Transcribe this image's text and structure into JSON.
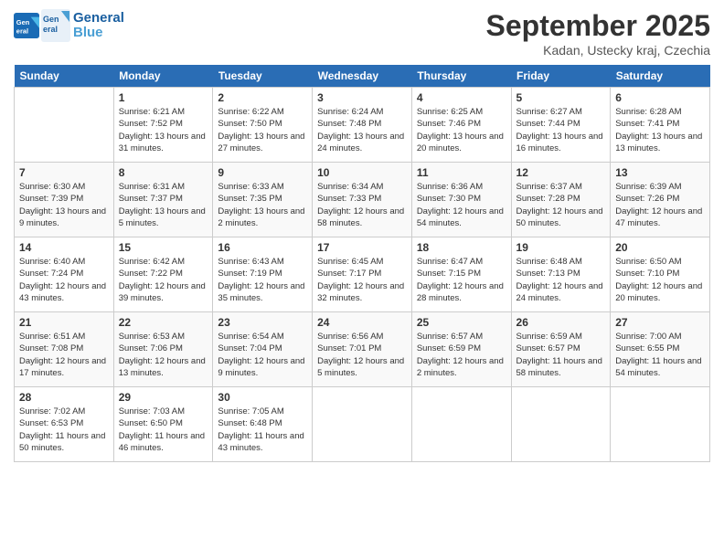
{
  "header": {
    "logo_line1": "General",
    "logo_line2": "Blue",
    "month_title": "September 2025",
    "location": "Kadan, Ustecky kraj, Czechia"
  },
  "days_of_week": [
    "Sunday",
    "Monday",
    "Tuesday",
    "Wednesday",
    "Thursday",
    "Friday",
    "Saturday"
  ],
  "weeks": [
    [
      {
        "num": "",
        "empty": true
      },
      {
        "num": "1",
        "sunrise": "6:21 AM",
        "sunset": "7:52 PM",
        "daylight": "13 hours and 31 minutes."
      },
      {
        "num": "2",
        "sunrise": "6:22 AM",
        "sunset": "7:50 PM",
        "daylight": "13 hours and 27 minutes."
      },
      {
        "num": "3",
        "sunrise": "6:24 AM",
        "sunset": "7:48 PM",
        "daylight": "13 hours and 24 minutes."
      },
      {
        "num": "4",
        "sunrise": "6:25 AM",
        "sunset": "7:46 PM",
        "daylight": "13 hours and 20 minutes."
      },
      {
        "num": "5",
        "sunrise": "6:27 AM",
        "sunset": "7:44 PM",
        "daylight": "13 hours and 16 minutes."
      },
      {
        "num": "6",
        "sunrise": "6:28 AM",
        "sunset": "7:41 PM",
        "daylight": "13 hours and 13 minutes."
      }
    ],
    [
      {
        "num": "7",
        "sunrise": "6:30 AM",
        "sunset": "7:39 PM",
        "daylight": "13 hours and 9 minutes."
      },
      {
        "num": "8",
        "sunrise": "6:31 AM",
        "sunset": "7:37 PM",
        "daylight": "13 hours and 5 minutes."
      },
      {
        "num": "9",
        "sunrise": "6:33 AM",
        "sunset": "7:35 PM",
        "daylight": "13 hours and 2 minutes."
      },
      {
        "num": "10",
        "sunrise": "6:34 AM",
        "sunset": "7:33 PM",
        "daylight": "12 hours and 58 minutes."
      },
      {
        "num": "11",
        "sunrise": "6:36 AM",
        "sunset": "7:30 PM",
        "daylight": "12 hours and 54 minutes."
      },
      {
        "num": "12",
        "sunrise": "6:37 AM",
        "sunset": "7:28 PM",
        "daylight": "12 hours and 50 minutes."
      },
      {
        "num": "13",
        "sunrise": "6:39 AM",
        "sunset": "7:26 PM",
        "daylight": "12 hours and 47 minutes."
      }
    ],
    [
      {
        "num": "14",
        "sunrise": "6:40 AM",
        "sunset": "7:24 PM",
        "daylight": "12 hours and 43 minutes."
      },
      {
        "num": "15",
        "sunrise": "6:42 AM",
        "sunset": "7:22 PM",
        "daylight": "12 hours and 39 minutes."
      },
      {
        "num": "16",
        "sunrise": "6:43 AM",
        "sunset": "7:19 PM",
        "daylight": "12 hours and 35 minutes."
      },
      {
        "num": "17",
        "sunrise": "6:45 AM",
        "sunset": "7:17 PM",
        "daylight": "12 hours and 32 minutes."
      },
      {
        "num": "18",
        "sunrise": "6:47 AM",
        "sunset": "7:15 PM",
        "daylight": "12 hours and 28 minutes."
      },
      {
        "num": "19",
        "sunrise": "6:48 AM",
        "sunset": "7:13 PM",
        "daylight": "12 hours and 24 minutes."
      },
      {
        "num": "20",
        "sunrise": "6:50 AM",
        "sunset": "7:10 PM",
        "daylight": "12 hours and 20 minutes."
      }
    ],
    [
      {
        "num": "21",
        "sunrise": "6:51 AM",
        "sunset": "7:08 PM",
        "daylight": "12 hours and 17 minutes."
      },
      {
        "num": "22",
        "sunrise": "6:53 AM",
        "sunset": "7:06 PM",
        "daylight": "12 hours and 13 minutes."
      },
      {
        "num": "23",
        "sunrise": "6:54 AM",
        "sunset": "7:04 PM",
        "daylight": "12 hours and 9 minutes."
      },
      {
        "num": "24",
        "sunrise": "6:56 AM",
        "sunset": "7:01 PM",
        "daylight": "12 hours and 5 minutes."
      },
      {
        "num": "25",
        "sunrise": "6:57 AM",
        "sunset": "6:59 PM",
        "daylight": "12 hours and 2 minutes."
      },
      {
        "num": "26",
        "sunrise": "6:59 AM",
        "sunset": "6:57 PM",
        "daylight": "11 hours and 58 minutes."
      },
      {
        "num": "27",
        "sunrise": "7:00 AM",
        "sunset": "6:55 PM",
        "daylight": "11 hours and 54 minutes."
      }
    ],
    [
      {
        "num": "28",
        "sunrise": "7:02 AM",
        "sunset": "6:53 PM",
        "daylight": "11 hours and 50 minutes."
      },
      {
        "num": "29",
        "sunrise": "7:03 AM",
        "sunset": "6:50 PM",
        "daylight": "11 hours and 46 minutes."
      },
      {
        "num": "30",
        "sunrise": "7:05 AM",
        "sunset": "6:48 PM",
        "daylight": "11 hours and 43 minutes."
      },
      {
        "num": "",
        "empty": true
      },
      {
        "num": "",
        "empty": true
      },
      {
        "num": "",
        "empty": true
      },
      {
        "num": "",
        "empty": true
      }
    ]
  ],
  "labels": {
    "sunrise": "Sunrise:",
    "sunset": "Sunset:",
    "daylight": "Daylight:"
  }
}
